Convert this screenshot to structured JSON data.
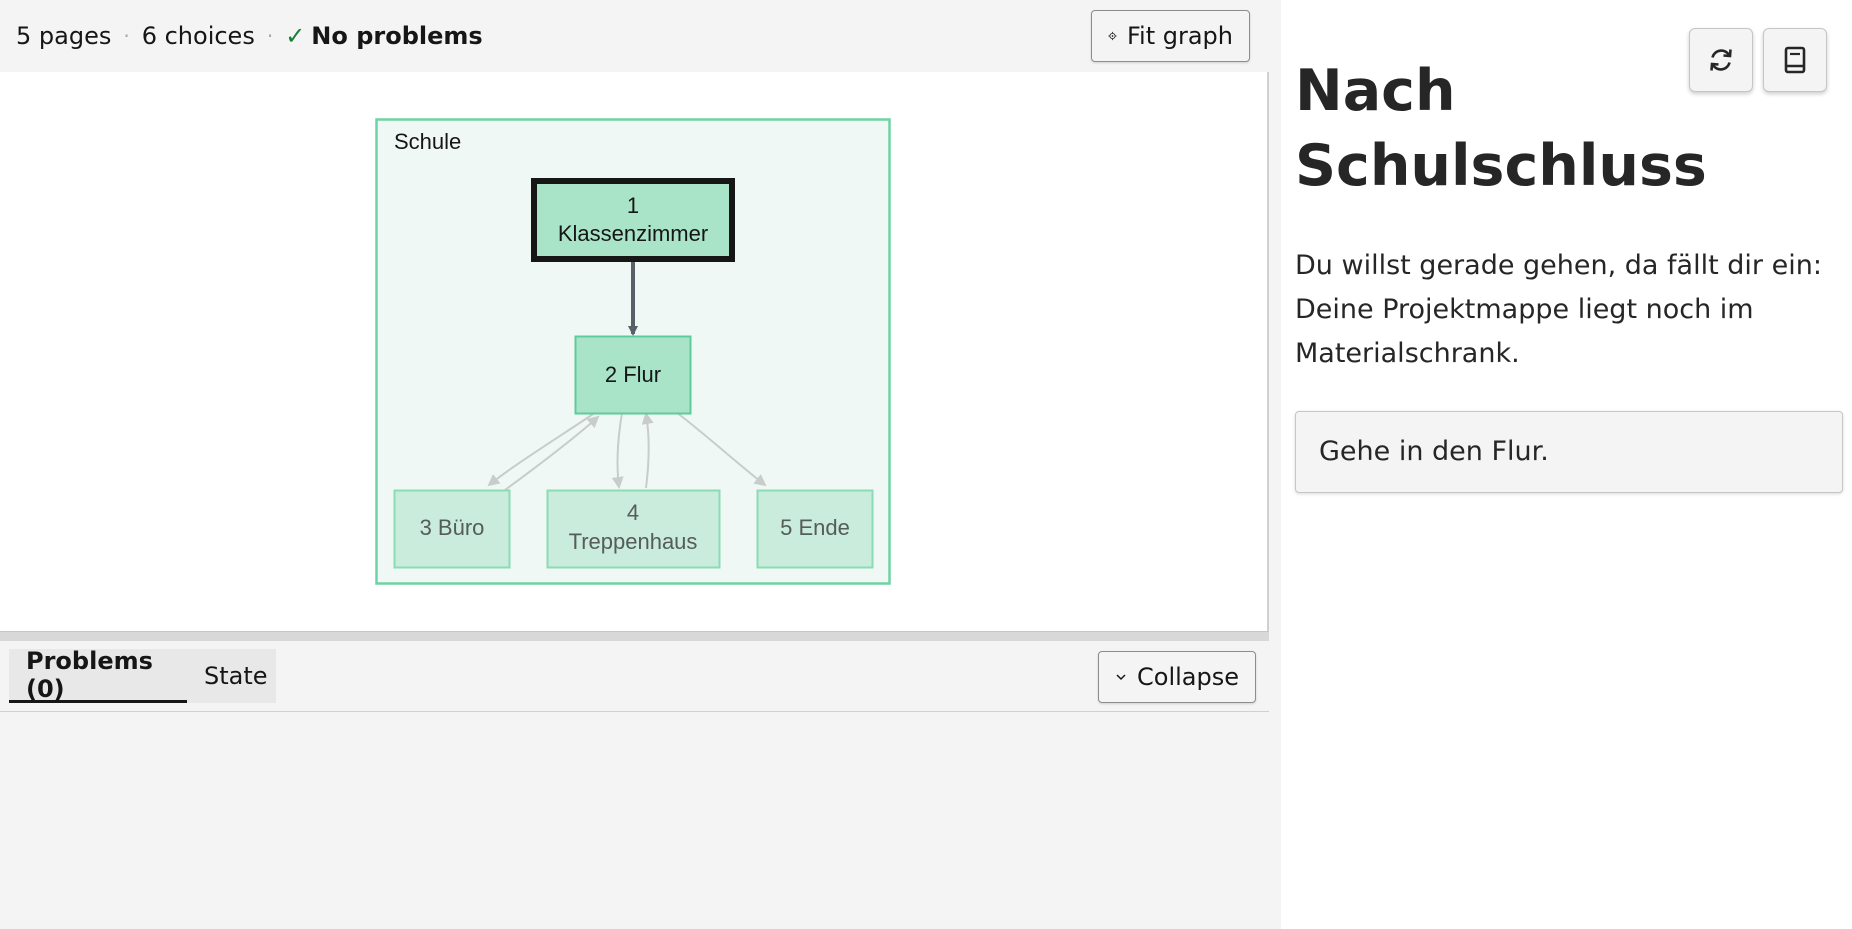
{
  "status": {
    "pages": "5 pages",
    "choices": "6 choices",
    "problems": "No problems"
  },
  "toolbar": {
    "fit_label": "Fit graph"
  },
  "graph": {
    "group_label": "Schule",
    "nodes": {
      "n1_num": "1",
      "n1_name": "Klassenzimmer",
      "n2": "2 Flur",
      "n3": "3 Büro",
      "n4_num": "4",
      "n4_name": "Treppenhaus",
      "n5": "5 Ende"
    }
  },
  "tabs": {
    "problems": "Problems (0)",
    "state": "State",
    "collapse": "Collapse"
  },
  "story": {
    "title": "Nach Schulschluss",
    "text": "Du willst gerade gehen, da fällt dir ein: Deine Projektmappe liegt noch im Materialschrank.",
    "choice": "Gehe in den Flur."
  },
  "icons": {
    "fit": "crosshair-icon",
    "collapse": "chevron-down-icon",
    "refresh": "refresh-icon",
    "book": "book-icon",
    "status_ok": "checkmark-icon"
  },
  "colors": {
    "node_fill": "#a9e4c9",
    "node_fill_faded": "#c9ecdc",
    "node_border": "#5ecb9a",
    "group_fill": "#f0f8f5",
    "active_border": "#161616",
    "ok_green": "#198038"
  }
}
